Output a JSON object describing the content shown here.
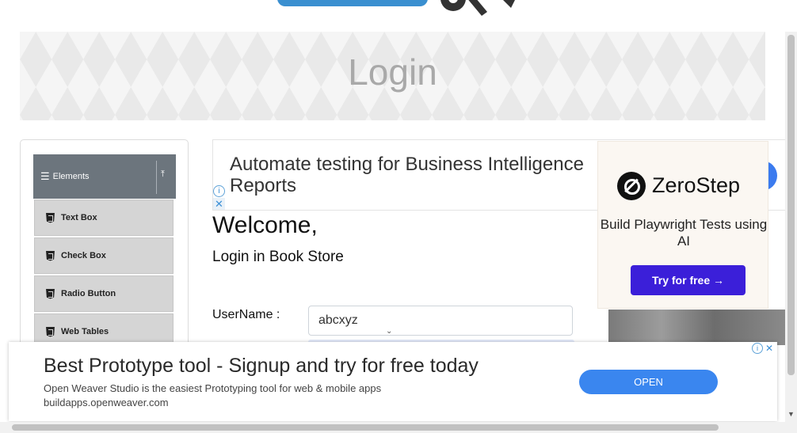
{
  "banner": {
    "title": "Login"
  },
  "sidebar": {
    "group_label": "Elements",
    "items": [
      {
        "label": "Text Box"
      },
      {
        "label": "Check Box"
      },
      {
        "label": "Radio Button"
      },
      {
        "label": "Web Tables"
      }
    ]
  },
  "top_ad": {
    "text": "Automate testing for Business Intelligence Reports"
  },
  "login": {
    "welcome": "Welcome,",
    "subtitle": "Login in Book Store",
    "username_label": "UserName :",
    "username_value": "abcxyz"
  },
  "side_ad": {
    "brand": "ZeroStep",
    "tagline": "Build Playwright Tests using AI",
    "cta": "Try for free →"
  },
  "bottom_ad": {
    "headline": "Best Prototype tool - Signup and try for free today",
    "description": "Open Weaver Studio is the easiest Prototyping tool for web & mobile apps",
    "url": "buildapps.openweaver.com",
    "button": "OPEN"
  },
  "colors": {
    "sidebar_header": "#6c757d",
    "cta_purple": "#3b1fd9",
    "ad_button_blue": "#3a86ef"
  }
}
